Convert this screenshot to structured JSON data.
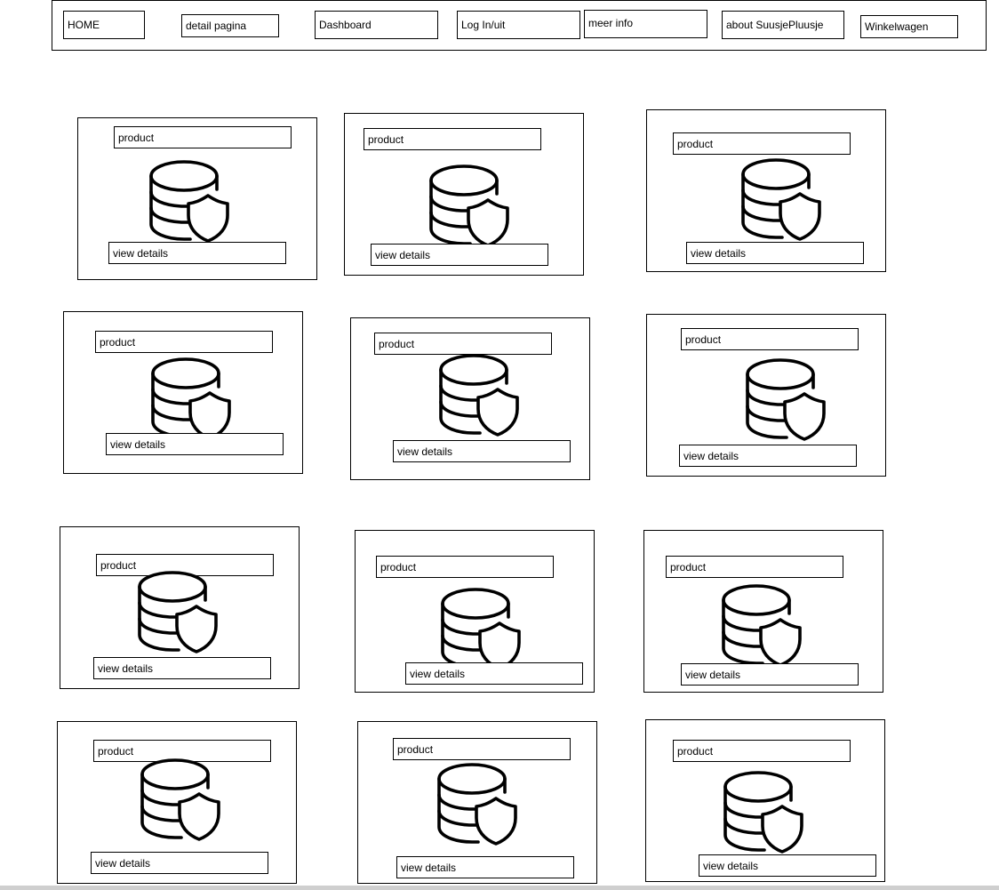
{
  "nav": {
    "items": [
      {
        "label": "HOME"
      },
      {
        "label": "detail pagina"
      },
      {
        "label": "Dashboard"
      },
      {
        "label": "Log In/uit"
      },
      {
        "label": "meer info"
      },
      {
        "label": "about SuusjePluusje"
      },
      {
        "label": "Winkelwagen"
      }
    ]
  },
  "products": [
    {
      "title": "product",
      "action": "view details",
      "icon": "database-shield-icon"
    },
    {
      "title": "product",
      "action": "view details",
      "icon": "database-shield-icon"
    },
    {
      "title": "product",
      "action": "view details",
      "icon": "database-shield-icon"
    },
    {
      "title": "product",
      "action": "view details",
      "icon": "database-shield-icon"
    },
    {
      "title": "product",
      "action": "view details",
      "icon": "database-shield-icon"
    },
    {
      "title": "product",
      "action": "view details",
      "icon": "database-shield-icon"
    },
    {
      "title": "product",
      "action": "view details",
      "icon": "database-shield-icon"
    },
    {
      "title": "product",
      "action": "view details",
      "icon": "database-shield-icon"
    },
    {
      "title": "product",
      "action": "view details",
      "icon": "database-shield-icon"
    },
    {
      "title": "product",
      "action": "view details",
      "icon": "database-shield-icon"
    },
    {
      "title": "product",
      "action": "view details",
      "icon": "database-shield-icon"
    },
    {
      "title": "product",
      "action": "view details",
      "icon": "database-shield-icon"
    }
  ]
}
